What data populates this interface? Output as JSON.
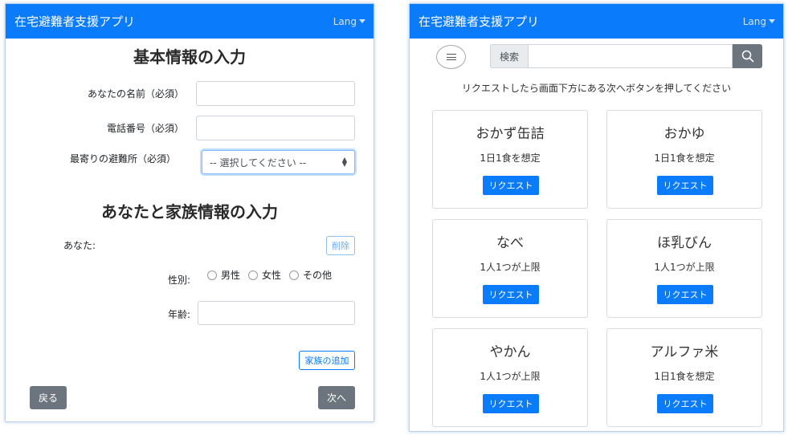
{
  "left": {
    "brand": "在宅避難者支援アプリ",
    "lang": "Lang",
    "title_basic": "基本情報の入力",
    "label_name": "あなたの名前（必須）",
    "label_phone": "電話番号（必須）",
    "label_shelter": "最寄りの避難所（必須）",
    "shelter_selected": "-- 選択してください --",
    "title_family": "あなたと家族情報の入力",
    "label_you": "あなた:",
    "delete": "削除",
    "label_gender": "性別:",
    "gender_options": [
      "男性",
      "女性",
      "その他"
    ],
    "label_age": "年齢:",
    "add_family": "家族の追加",
    "back": "戻る",
    "next": "次へ"
  },
  "right": {
    "brand": "在宅避難者支援アプリ",
    "lang": "Lang",
    "search_label": "検索",
    "search_placeholder": "",
    "hint": "リクエストしたら画面下方にある次へボタンを押してください",
    "items": [
      {
        "name": "おかず缶詰",
        "note": "1日1食を想定",
        "button": "リクエスト"
      },
      {
        "name": "おかゆ",
        "note": "1日1食を想定",
        "button": "リクエスト"
      },
      {
        "name": "なべ",
        "note": "1人1つが上限",
        "button": "リクエスト"
      },
      {
        "name": "ほ乳びん",
        "note": "1人1つが上限",
        "button": "リクエスト"
      },
      {
        "name": "やかん",
        "note": "1人1つが上限",
        "button": "リクエスト"
      },
      {
        "name": "アルファ米",
        "note": "1日1食を想定",
        "button": "リクエスト"
      }
    ]
  }
}
